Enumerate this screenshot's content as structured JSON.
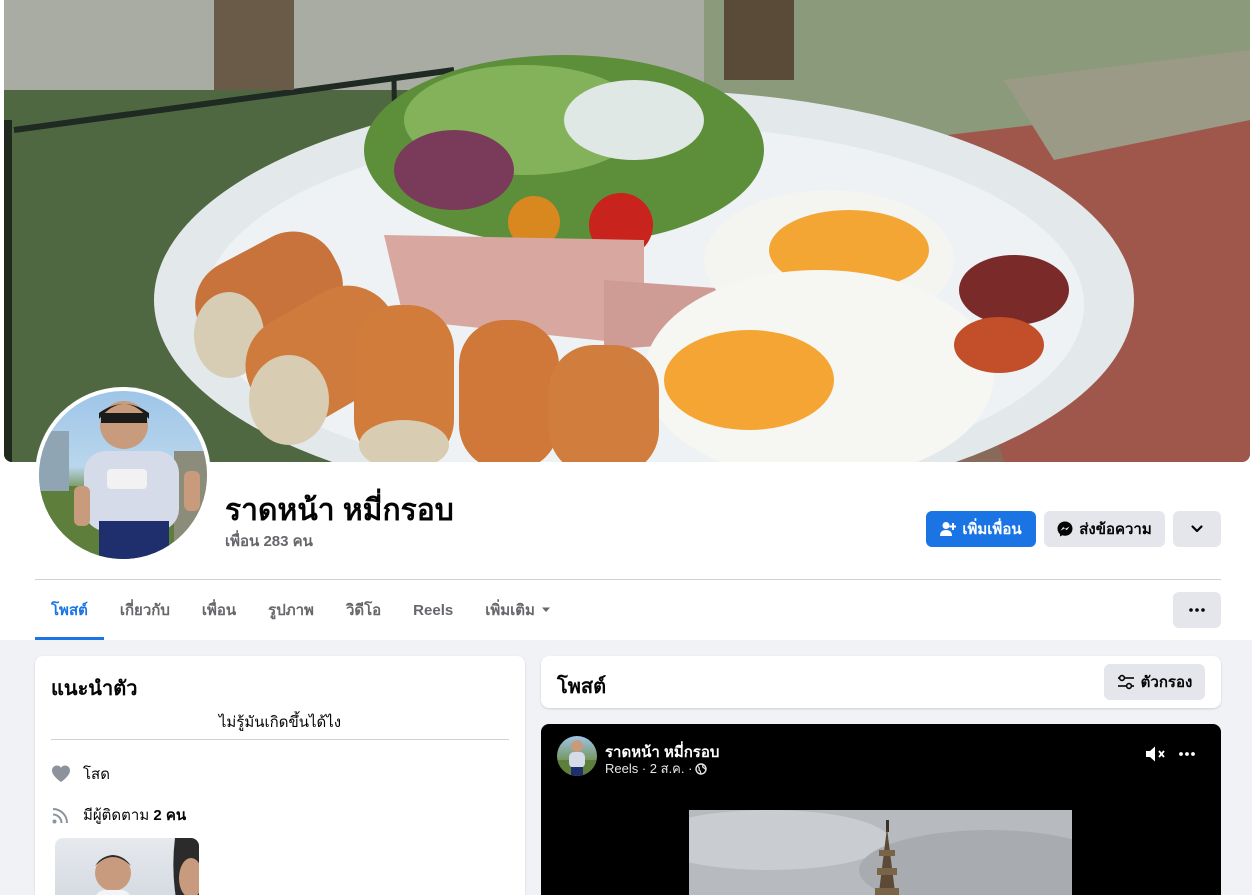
{
  "profile": {
    "name": "ราดหน้า หมี่กรอบ",
    "friends_count": "เพื่อน 283 คน"
  },
  "actions": {
    "add_friend": "เพิ่มเพื่อน",
    "message": "ส่งข้อความ"
  },
  "tabs": [
    {
      "label": "โพสต์",
      "active": true
    },
    {
      "label": "เกี่ยวกับ",
      "active": false
    },
    {
      "label": "เพื่อน",
      "active": false
    },
    {
      "label": "รูปภาพ",
      "active": false
    },
    {
      "label": "วิดีโอ",
      "active": false
    },
    {
      "label": "Reels",
      "active": false
    },
    {
      "label": "เพิ่มเติม",
      "active": false
    }
  ],
  "intro": {
    "title": "แนะนำตัว",
    "bio": "ไม่รู้มันเกิดขึ้นได้ไง",
    "relationship": "โสด",
    "followers_prefix": "มีผู้ติดตาม",
    "followers_count": "2 คน"
  },
  "posts": {
    "title": "โพสต์",
    "filter_label": "ตัวกรอง"
  },
  "reel_post": {
    "author": "ราดหน้า หมี่กรอบ",
    "meta": "Reels · 2 ส.ค. ·"
  },
  "colors": {
    "accent": "#1b74e4",
    "secondary_button": "#e4e6eb",
    "page_background": "#f0f2f5",
    "muted_text": "#65676b"
  }
}
